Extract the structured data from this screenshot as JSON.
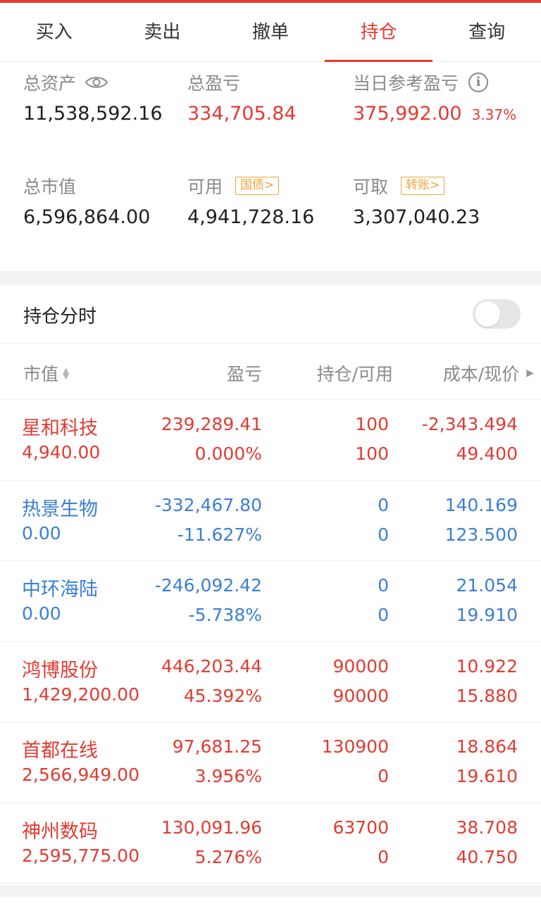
{
  "tabs": [
    {
      "label": "买入",
      "active": false
    },
    {
      "label": "卖出",
      "active": false
    },
    {
      "label": "撤单",
      "active": false
    },
    {
      "label": "持仓",
      "active": true
    },
    {
      "label": "查询",
      "active": false
    }
  ],
  "summary": {
    "total_assets_label": "总资产",
    "total_assets": "11,538,592.16",
    "total_pl_label": "总盈亏",
    "total_pl": "334,705.84",
    "daily_pl_label": "当日参考盈亏",
    "daily_pl": "375,992.00",
    "daily_pl_pct": "3.37%",
    "market_value_label": "总市值",
    "market_value": "6,596,864.00",
    "available_label": "可用",
    "available_badge": "国债>",
    "available": "4,941,728.16",
    "withdrawable_label": "可取",
    "withdrawable_badge": "转账>",
    "withdrawable": "3,307,040.23"
  },
  "holding_time": {
    "label": "持仓分时",
    "enabled": false
  },
  "table": {
    "headers": [
      "市值",
      "盈亏",
      "持仓/可用",
      "成本/现价"
    ],
    "rows": [
      {
        "name": "星和科技",
        "market_value": "4,940.00",
        "pl": "239,289.41",
        "pl_pct": "0.000%",
        "position": "100",
        "available": "100",
        "cost": "-2,343.494",
        "price": "49.400",
        "color": "#e23b32"
      },
      {
        "name": "热景生物",
        "market_value": "0.00",
        "pl": "-332,467.80",
        "pl_pct": "-11.627%",
        "position": "0",
        "available": "0",
        "cost": "140.169",
        "price": "123.500",
        "color": "#3a7fd5"
      },
      {
        "name": "中环海陆",
        "market_value": "0.00",
        "pl": "-246,092.42",
        "pl_pct": "-5.738%",
        "position": "0",
        "available": "0",
        "cost": "21.054",
        "price": "19.910",
        "color": "#3a7fd5"
      },
      {
        "name": "鸿博股份",
        "market_value": "1,429,200.00",
        "pl": "446,203.44",
        "pl_pct": "45.392%",
        "position": "90000",
        "available": "90000",
        "cost": "10.922",
        "price": "15.880",
        "color": "#e23b32"
      },
      {
        "name": "首都在线",
        "market_value": "2,566,949.00",
        "pl": "97,681.25",
        "pl_pct": "3.956%",
        "position": "130900",
        "available": "0",
        "cost": "18.864",
        "price": "19.610",
        "color": "#e23b32"
      },
      {
        "name": "神州数码",
        "market_value": "2,595,775.00",
        "pl": "130,091.96",
        "pl_pct": "5.276%",
        "position": "63700",
        "available": "0",
        "cost": "38.708",
        "price": "40.750",
        "color": "#e23b32"
      }
    ]
  }
}
